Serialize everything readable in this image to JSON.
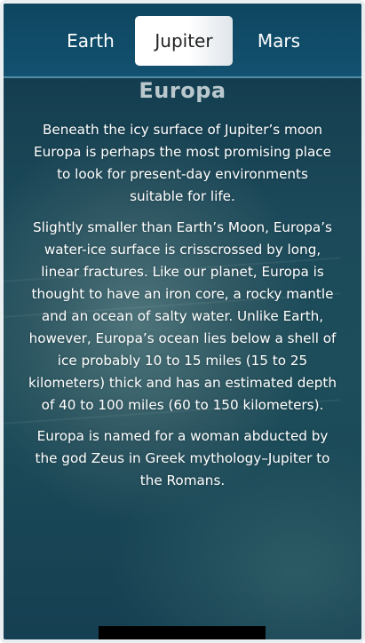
{
  "nav": {
    "tabs": [
      {
        "label": "Earth"
      },
      {
        "label": "Jupiter",
        "selected": true
      },
      {
        "label": "Mars"
      }
    ]
  },
  "article": {
    "title": "Europa",
    "paragraphs": [
      "Beneath the icy surface of Jupiter’s moon Europa is perhaps the most promising place to look for present-day environments suitable for life.",
      "Slightly smaller than Earth’s Moon, Europa’s water-ice surface is crisscrossed by long, linear fractures. Like our planet, Europa is thought to have an iron core, a rocky mantle and an ocean of salty water. Unlike Earth, however, Europa’s ocean lies below a shell of ice probably 10 to 15 miles (15 to 25 kilometers) thick and has an estimated depth of 40 to 100 miles (60 to 150 kilometers).",
      "Europa is named for a woman abducted by the god Zeus in Greek mythology–Jupiter to the Romans."
    ]
  },
  "colors": {
    "header": "#0e4660",
    "selected_tab_bg": "#ffffff",
    "text": "#ffffff"
  }
}
